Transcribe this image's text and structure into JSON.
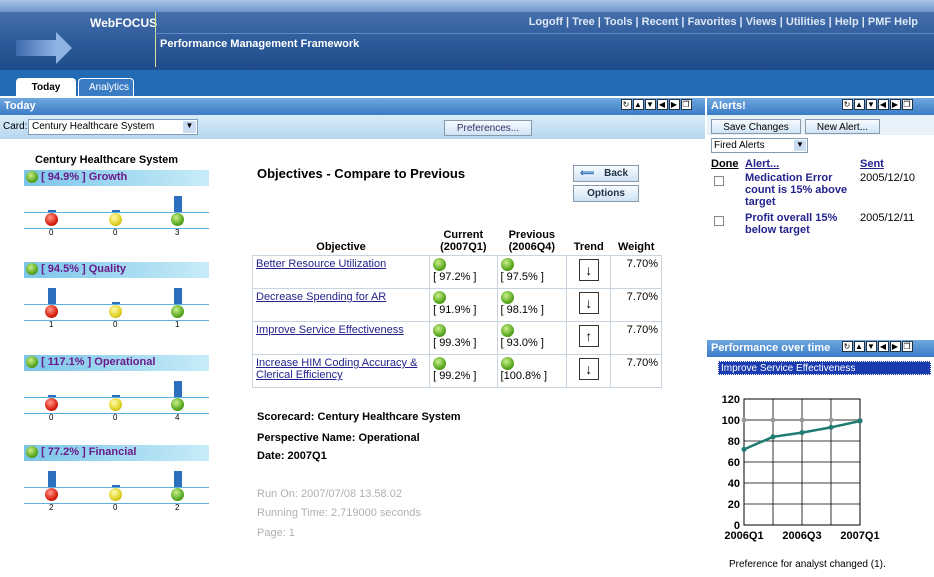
{
  "header": {
    "logo": "WebFOCUS",
    "app_name": "Performance Management Framework",
    "links": [
      "Logoff",
      "Tree",
      "Tools",
      "Recent",
      "Favorites",
      "Views",
      "Utilities",
      "Help",
      "PMF Help"
    ]
  },
  "tabs": [
    {
      "label": "Today"
    },
    {
      "label": "Analytics"
    }
  ],
  "today_panel": {
    "title": "Today",
    "card_label": "Card:",
    "card_value": "Century Healthcare System",
    "preferences_label": "Preferences..."
  },
  "scorecard": {
    "title": "Century Healthcare System",
    "perspectives": [
      {
        "label": "[ 94.9% ] Growth",
        "counts": [
          "0",
          "0",
          "3"
        ]
      },
      {
        "label": "[ 94.5% ] Quality",
        "counts": [
          "1",
          "0",
          "1"
        ]
      },
      {
        "label": "[ 117.1% ] Operational",
        "counts": [
          "0",
          "0",
          "4"
        ]
      },
      {
        "label": "[ 77.2% ] Financial",
        "counts": [
          "2",
          "0",
          "2"
        ]
      }
    ]
  },
  "objectives": {
    "heading": "Objectives - Compare to Previous",
    "back_label": "Back",
    "options_label": "Options",
    "columns": [
      "Objective",
      "Current\n(2007Q1)",
      "Previous\n(2006Q4)",
      "Trend",
      "Weight"
    ],
    "rows": [
      {
        "name": "Better Resource Utilization",
        "current": "[ 97.2% ]",
        "previous": "[ 97.5% ]",
        "trend": "↓",
        "weight": "7.70%"
      },
      {
        "name": "Decrease Spending for AR",
        "current": "[ 91.9% ]",
        "previous": "[ 98.1% ]",
        "trend": "↓",
        "weight": "7.70%"
      },
      {
        "name": "Improve Service Effectiveness",
        "current": "[ 99.3% ]",
        "previous": "[ 93.0% ]",
        "trend": "↑",
        "weight": "7.70%"
      },
      {
        "name": "Increase HIM Coding Accuracy & Clerical Efficiency",
        "current": "[ 99.2% ]",
        "previous": "[100.8% ]",
        "trend": "↓",
        "weight": "7.70%"
      }
    ],
    "scorecard_line": "Scorecard: Century Healthcare System",
    "perspective_line": "Perspective Name: Operational",
    "date_line": "Date: 2007Q1",
    "run_on": "Run On: 2007/07/08 13.58.02",
    "running_time": "Running Time: 2.719000 seconds",
    "page": "Page: 1"
  },
  "alerts": {
    "title": "Alerts!",
    "save_label": "Save Changes",
    "new_label": "New Alert...",
    "filter_value": "Fired Alerts",
    "col_done": "Done",
    "col_alert": "Alert...",
    "col_sent": "Sent",
    "items": [
      {
        "text": "Medication Error count is 15% above target",
        "sent": "2005/12/10"
      },
      {
        "text": "Profit overall 15% below target",
        "sent": "2005/12/11"
      }
    ]
  },
  "performance": {
    "title": "Performance over time",
    "selected": "Improve Service Effectiveness",
    "footer": "Preference for analyst  changed (1)."
  },
  "chart_data": {
    "type": "line",
    "x": [
      "2006Q1",
      "2006Q2",
      "2006Q3",
      "2006Q4",
      "2007Q1"
    ],
    "xtick_labels": [
      "2006Q1",
      "2006Q3",
      "2007Q1"
    ],
    "ylim": [
      0,
      120
    ],
    "yticks": [
      0,
      20,
      40,
      60,
      80,
      100,
      120
    ],
    "grid": true,
    "series": [
      {
        "values": [
          100,
          100,
          100,
          100,
          100
        ],
        "color": "#999999"
      },
      {
        "values": [
          72,
          84,
          88,
          93,
          99
        ],
        "color": "#1f7a72"
      }
    ]
  }
}
